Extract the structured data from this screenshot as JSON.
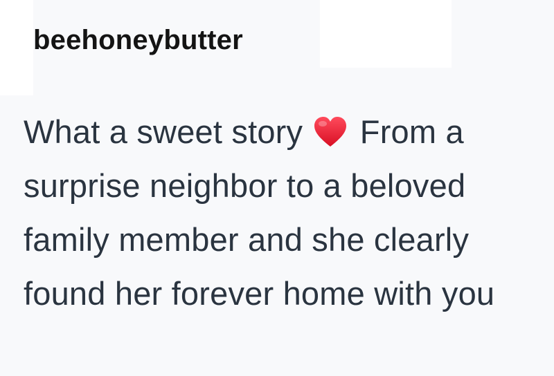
{
  "comment": {
    "username": "beehoneybutter",
    "text_part1": "What a sweet story",
    "heart_icon": "red-heart-icon",
    "text_part2": "From a surprise neighbor to a beloved family member and she clearly found her forever home with you"
  },
  "colors": {
    "background": "#f8f9fb",
    "username": "#141414",
    "body_text": "#2a3440",
    "heart": "#e0162b"
  }
}
